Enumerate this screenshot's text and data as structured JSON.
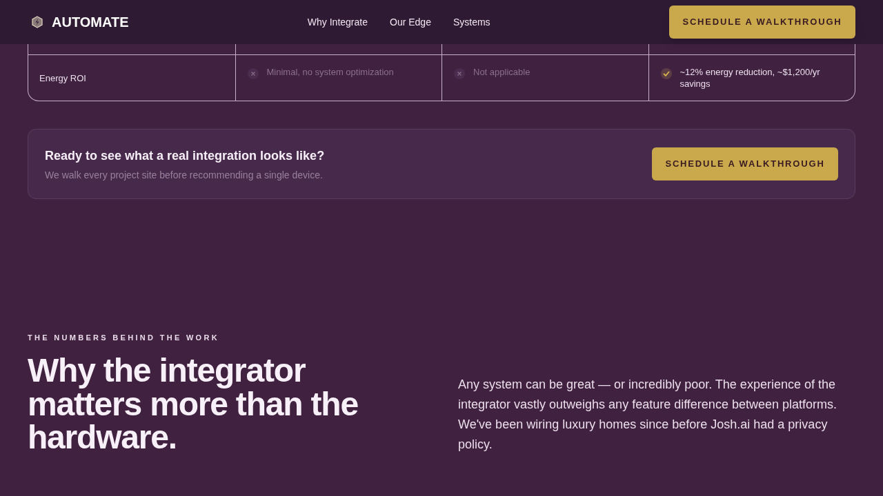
{
  "header": {
    "brand": "AUTOMATE",
    "nav": [
      {
        "label": "Why Integrate"
      },
      {
        "label": "Our Edge"
      },
      {
        "label": "Systems"
      }
    ],
    "cta": "SCHEDULE A WALKTHROUGH"
  },
  "comparison_table": {
    "rows": [
      {
        "label": "Energy ROI",
        "cells": [
          {
            "text": "Minimal, no system optimization",
            "positive": false
          },
          {
            "text": "Not applicable",
            "positive": false
          },
          {
            "text": "~12% energy reduction, ~$1,200/yr savings",
            "positive": true
          }
        ]
      }
    ]
  },
  "cta_card": {
    "title": "Ready to see what a real integration looks like?",
    "subtitle": "We walk every project site before recommending a single device.",
    "button": "SCHEDULE A WALKTHROUGH"
  },
  "section": {
    "eyebrow": "THE NUMBERS BEHIND THE WORK",
    "heading": "Why the integrator matters more than the hardware.",
    "body": "Any system can be great — or incredibly poor. The experience of the integrator vastly outweighs any feature difference between platforms. We've been wiring luxury homes since before Josh.ai had a privacy policy."
  }
}
